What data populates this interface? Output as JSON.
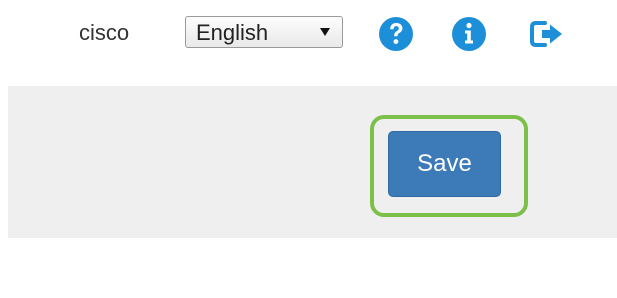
{
  "header": {
    "username": "cisco",
    "language_select": {
      "selected": "English"
    },
    "icons": {
      "help": "help-icon",
      "info": "info-icon",
      "logout": "logout-icon"
    },
    "accent_color": "#1d8fd8"
  },
  "action_bar": {
    "save_label": "Save",
    "save_color": "#3c7ab8",
    "highlight_color": "#7cc04b"
  }
}
